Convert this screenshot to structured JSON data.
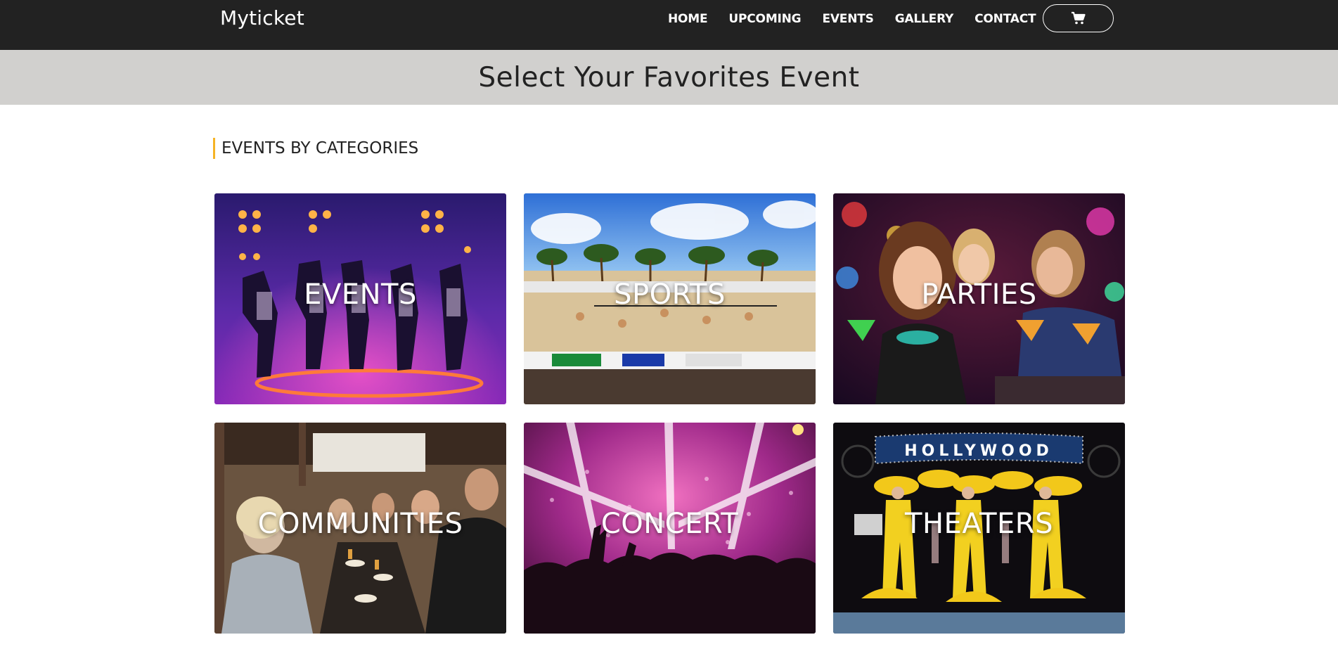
{
  "brand": "Myticket",
  "nav": {
    "items": [
      {
        "label": "HOME"
      },
      {
        "label": "UPCOMING"
      },
      {
        "label": "EVENTS"
      },
      {
        "label": "GALLERY"
      },
      {
        "label": "CONTACT"
      }
    ],
    "cart_icon": "shopping-cart-icon"
  },
  "hero": {
    "title": "Select Your Favorites Event"
  },
  "section": {
    "title": "EVENTS BY CATEGORIES",
    "accent_color": "#f5b325"
  },
  "categories": [
    {
      "label": "EVENTS"
    },
    {
      "label": "SPORTS"
    },
    {
      "label": "PARTIES"
    },
    {
      "label": "COMMUNITIES"
    },
    {
      "label": "CONCERT"
    },
    {
      "label": "THEATERS"
    }
  ],
  "theater_sign": "HOLLYWOOD",
  "colors": {
    "navbar_bg": "#222222",
    "hero_bg": "#d1d0ce",
    "accent": "#f5b325"
  }
}
